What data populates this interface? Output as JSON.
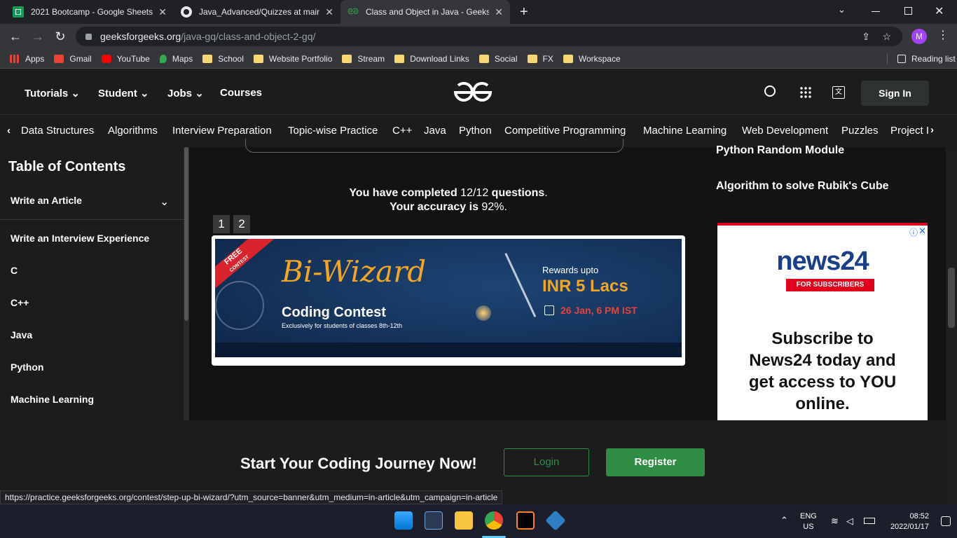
{
  "tabs": [
    {
      "title": "2021 Bootcamp - Google Sheets",
      "icon": "google-sheets-icon",
      "active": false
    },
    {
      "title": "Java_Advanced/Quizzes at main",
      "icon": "github-icon",
      "active": false
    },
    {
      "title": "Class and Object in Java - GeeksG",
      "icon": "gfg-icon",
      "active": true
    }
  ],
  "url": {
    "host": "geeksforgeeks.org",
    "path": "/java-gq/class-and-object-2-gq/"
  },
  "profile_initial": "M",
  "bookmarks": [
    {
      "label": "Apps",
      "icon": "apps-grid-icon"
    },
    {
      "label": "Gmail",
      "icon": "gmail-icon"
    },
    {
      "label": "YouTube",
      "icon": "youtube-icon"
    },
    {
      "label": "Maps",
      "icon": "maps-icon"
    },
    {
      "label": "School",
      "icon": "folder-icon"
    },
    {
      "label": "Website Portfolio",
      "icon": "folder-icon"
    },
    {
      "label": "Stream",
      "icon": "folder-icon"
    },
    {
      "label": "Download Links",
      "icon": "folder-icon"
    },
    {
      "label": "Social",
      "icon": "folder-icon"
    },
    {
      "label": "FX",
      "icon": "folder-icon"
    },
    {
      "label": "Workspace",
      "icon": "folder-icon"
    }
  ],
  "reading_list": "Reading list",
  "header": {
    "menus": [
      "Tutorials",
      "Student",
      "Jobs",
      "Courses"
    ],
    "sign_in": "Sign In"
  },
  "subnav": [
    "Data Structures",
    "Algorithms",
    "Interview Preparation",
    "Topic-wise Practice",
    "C++",
    "Java",
    "Python",
    "Competitive Programming",
    "Machine Learning",
    "Web Development",
    "Puzzles",
    "Project Ideas"
  ],
  "toc": {
    "title": "Table of Contents",
    "items": [
      "Write an Article",
      "Write an Interview Experience",
      "C",
      "C++",
      "Java",
      "Python",
      "Machine Learning"
    ]
  },
  "quiz": {
    "completed_prefix": "You have completed",
    "completed_value": "12/12",
    "completed_suffix": "questions",
    "accuracy_prefix": "Your accuracy is",
    "accuracy_value": "92%",
    "pages": [
      "1",
      "2"
    ]
  },
  "banner": {
    "ribbon_top": "FREE",
    "ribbon_bottom": "CONTEST",
    "title": "Bi-Wizard",
    "subtitle": "Coding Contest",
    "tagline": "Exclusively for students of classes 8th-12th",
    "rewards_label": "Rewards upto",
    "rewards_value": "INR 5 Lacs",
    "date": "26 Jan, 6 PM IST"
  },
  "right_links": [
    "Python Random Module",
    "Algorithm to solve Rubik's Cube"
  ],
  "ad": {
    "logo": "news24",
    "logo_sub": "FOR SUBSCRIBERS",
    "text": "Subscribe to News24 today and get access to YOU online."
  },
  "cta": {
    "text": "Start Your Coding Journey Now!",
    "login": "Login",
    "register": "Register"
  },
  "status_url": "https://practice.geeksforgeeks.org/contest/step-up-bi-wizard/?utm_source=banner&utm_medium=in-article&utm_campaign=in-article",
  "taskbar": {
    "lang": "ENG",
    "region": "US",
    "time": "08:52",
    "date": "2022/01/17"
  },
  "colors": {
    "gfg_green": "#2f8d46",
    "news24_red": "#e0001b",
    "news24_blue": "#1b3f8b",
    "banner_bg": "#132f5a"
  }
}
